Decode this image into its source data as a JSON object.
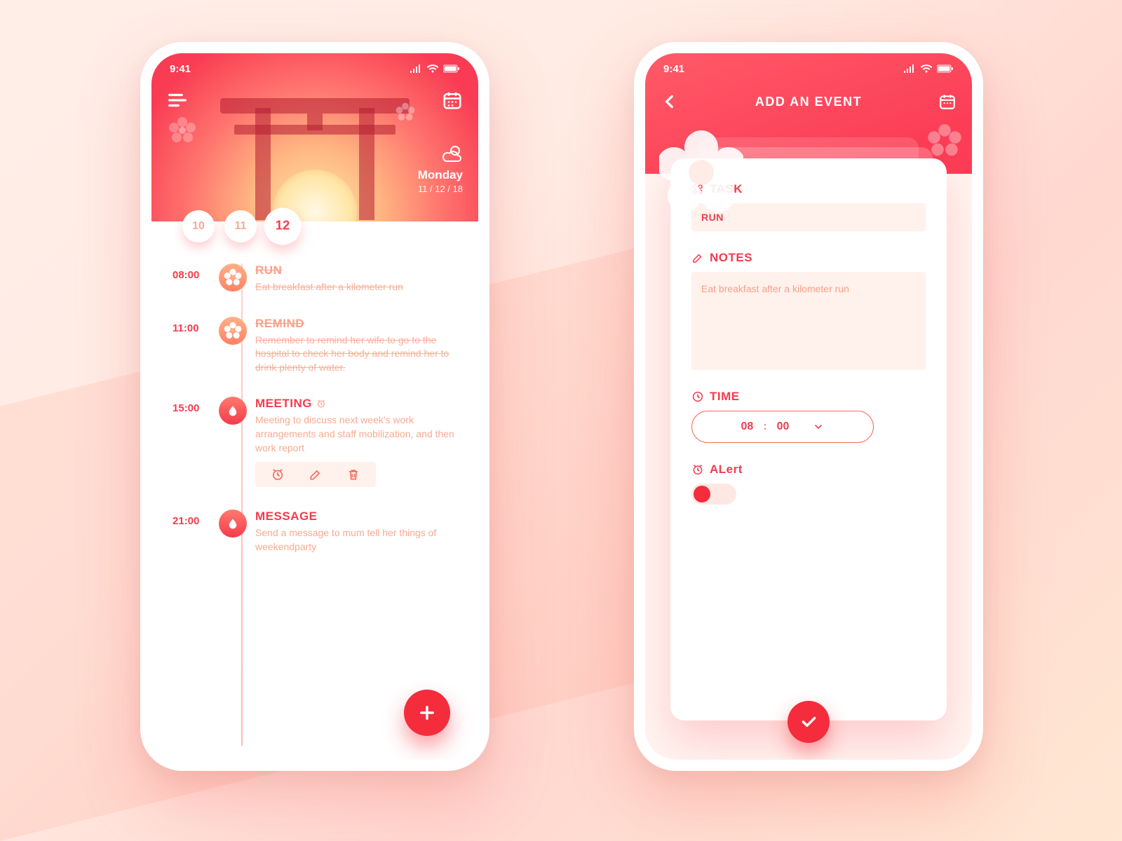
{
  "status": {
    "time": "9:41"
  },
  "colors": {
    "accent": "#f43b4d",
    "soft": "#fff1ec"
  },
  "left": {
    "day_name": "Monday",
    "date": "11 / 12 / 18",
    "days": [
      {
        "label": "10",
        "active": false
      },
      {
        "label": "11",
        "active": false
      },
      {
        "label": "12",
        "active": true
      }
    ],
    "events": [
      {
        "time": "08:00",
        "title": "RUN",
        "desc": "Eat breakfast after a kilometer run",
        "done": true,
        "kind": "flower"
      },
      {
        "time": "11:00",
        "title": "REMIND",
        "desc": "Remember to remind her wife to go to the hospital to check her body and remind her to drink plenty of water.",
        "done": true,
        "kind": "flower"
      },
      {
        "time": "15:00",
        "title": "MEETING",
        "desc": "Meeting to discuss next week's work arrangements and staff mobilization,  and then work report",
        "done": false,
        "kind": "drop",
        "has_timer_badge": true,
        "show_actions": true
      },
      {
        "time": "21:00",
        "title": "MESSAGE",
        "desc": "Send a message to mum tell her things of weekendparty",
        "done": false,
        "kind": "drop"
      }
    ]
  },
  "right": {
    "title": "ADD AN EVENT",
    "task_label": "TASK",
    "task_value": "RUN",
    "notes_label": "NOTES",
    "notes_value": "Eat breakfast after a kilometer run",
    "time_label": "TIME",
    "time_hour": "08",
    "time_min": "00",
    "alert_label": "ALert",
    "alert_on": false
  }
}
